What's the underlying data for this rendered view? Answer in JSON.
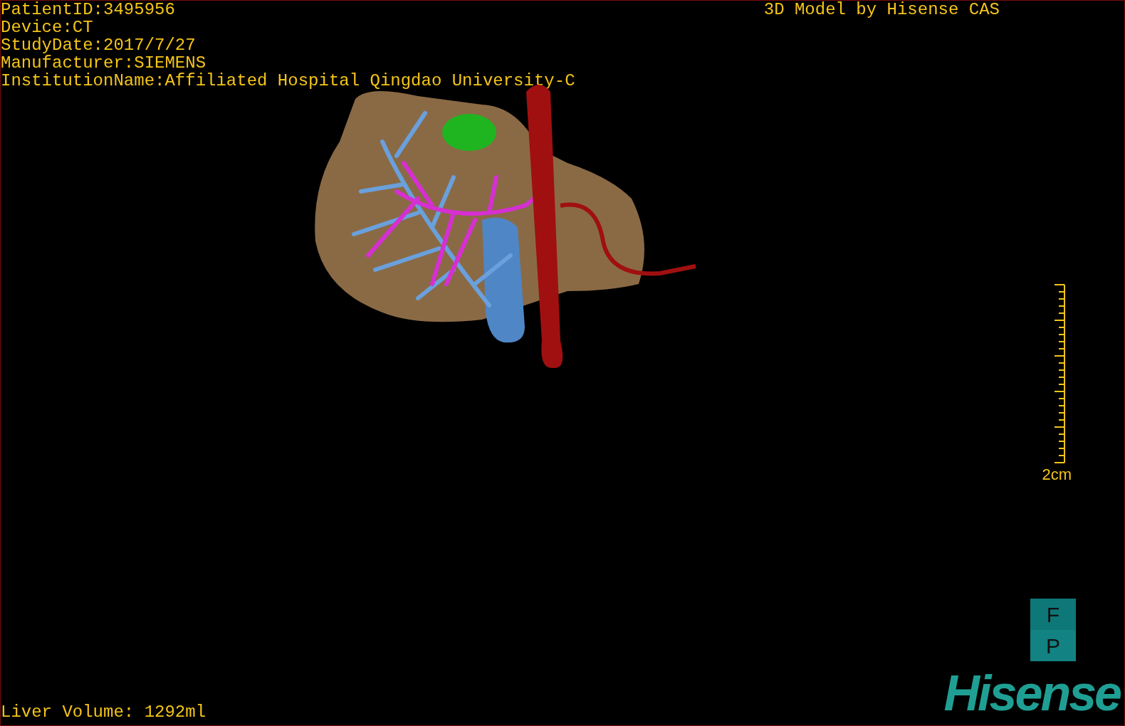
{
  "study_info": [
    "PatientID:3495956",
    "Device:CT",
    "StudyDate:2017/7/27",
    "Manufacturer:SIEMENS",
    "InstitutionName:Affiliated Hospital Qingdao University-C"
  ],
  "credit": "3D Model by Hisense CAS",
  "scale_bar": {
    "label": "2cm"
  },
  "orientation_cube": [
    "F",
    "P"
  ],
  "volume_readout": "Liver Volume: 1292ml",
  "logo": "Hisense"
}
